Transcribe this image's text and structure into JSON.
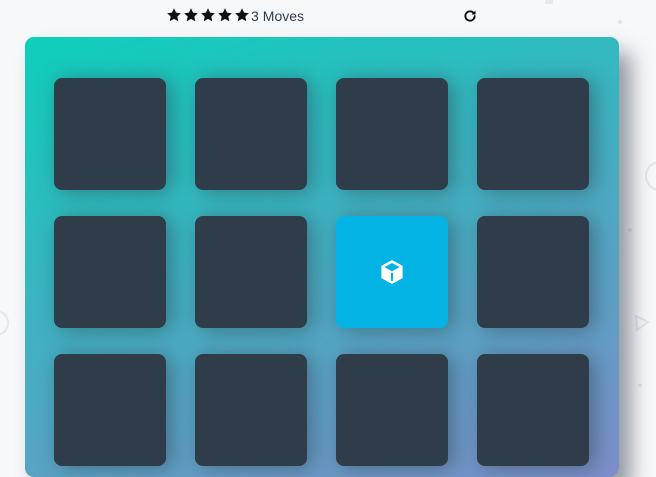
{
  "score_panel": {
    "stars": [
      {
        "icon": "star-icon",
        "filled": true
      },
      {
        "icon": "star-icon",
        "filled": true
      },
      {
        "icon": "star-icon",
        "filled": true
      },
      {
        "icon": "star-icon",
        "filled": true
      },
      {
        "icon": "star-icon",
        "filled": true
      }
    ],
    "moves_count": "3",
    "moves_label": "Moves",
    "restart_icon": "restart-icon"
  },
  "deck": {
    "gradient_start": "#0dcfbc",
    "gradient_end": "#7e8ec9",
    "card_color": "#2e3d49",
    "open_card_color": "#02b3e4",
    "cards": [
      {
        "state": "closed"
      },
      {
        "state": "closed"
      },
      {
        "state": "closed"
      },
      {
        "state": "closed"
      },
      {
        "state": "closed"
      },
      {
        "state": "closed"
      },
      {
        "state": "open",
        "icon": "cube-icon"
      },
      {
        "state": "closed"
      },
      {
        "state": "closed"
      },
      {
        "state": "closed"
      },
      {
        "state": "closed"
      },
      {
        "state": "closed"
      }
    ]
  },
  "colors": {
    "text": "#2e3d49",
    "page_bg": "#f7f8fa"
  }
}
